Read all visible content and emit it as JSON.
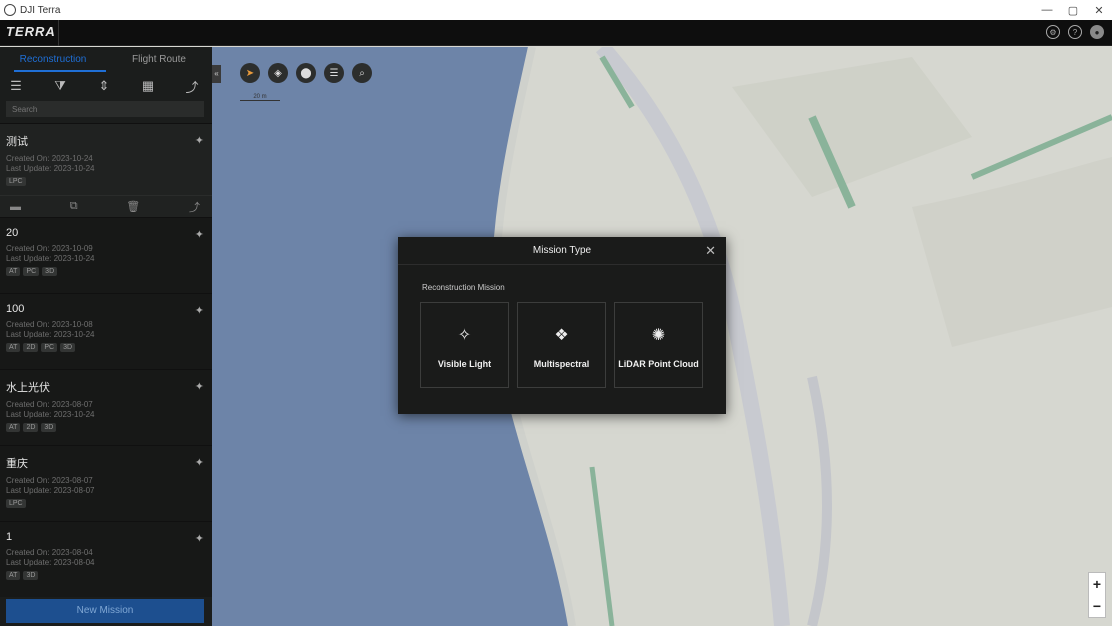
{
  "os_window": {
    "title": "DJI Terra",
    "controls": [
      "—",
      "▢",
      "✕"
    ]
  },
  "header": {
    "logo": "TERRA",
    "icons": [
      "settings-icon",
      "help-icon",
      "user-icon"
    ]
  },
  "sidebar": {
    "tabs": [
      {
        "label": "Reconstruction",
        "active": true
      },
      {
        "label": "Flight Route",
        "active": false
      }
    ],
    "toolbar_icons": [
      "list-icon",
      "filter-icon",
      "sort-icon",
      "grid-icon",
      "import-icon"
    ],
    "search_placeholder": "Search",
    "missions": [
      {
        "name": "测试",
        "created": "Created On: 2023-10-24",
        "updated": "Last Update: 2023-10-24",
        "tags": [
          "LPC"
        ]
      },
      {
        "name": "20",
        "created": "Created On: 2023-10-09",
        "updated": "Last Update: 2023-10-24",
        "tags": [
          "AT",
          "PC",
          "3D"
        ]
      },
      {
        "name": "100",
        "created": "Created On: 2023-10-08",
        "updated": "Last Update: 2023-10-24",
        "tags": [
          "AT",
          "2D",
          "PC",
          "3D"
        ]
      },
      {
        "name": "水上光伏",
        "created": "Created On: 2023-08-07",
        "updated": "Last Update: 2023-10-24",
        "tags": [
          "AT",
          "2D",
          "3D"
        ]
      },
      {
        "name": "重庆",
        "created": "Created On: 2023-08-07",
        "updated": "Last Update: 2023-08-07",
        "tags": [
          "LPC"
        ]
      },
      {
        "name": "1",
        "created": "Created On: 2023-08-04",
        "updated": "Last Update: 2023-08-04",
        "tags": [
          "AT",
          "3D"
        ]
      }
    ],
    "selected_actions": [
      "folder-icon",
      "copy-icon",
      "delete-icon",
      "export-icon"
    ],
    "new_mission_label": "New Mission"
  },
  "map": {
    "scale_label": "20 m",
    "tool_icons": [
      "compass-icon",
      "locate-icon",
      "pin-icon",
      "layers-icon",
      "search-icon"
    ],
    "zoom_in": "+",
    "zoom_out": "−",
    "colors": {
      "water": "#6d84a8",
      "land": "#d6d7d0",
      "green": "#8ab39a"
    }
  },
  "modal": {
    "title": "Mission Type",
    "close": "✕",
    "section": "Reconstruction Mission",
    "options": [
      {
        "label": "Visible Light",
        "icon": "visible-light-icon"
      },
      {
        "label": "Multispectral",
        "icon": "multispectral-icon"
      },
      {
        "label": "LiDAR Point Cloud",
        "icon": "lidar-icon"
      }
    ]
  }
}
